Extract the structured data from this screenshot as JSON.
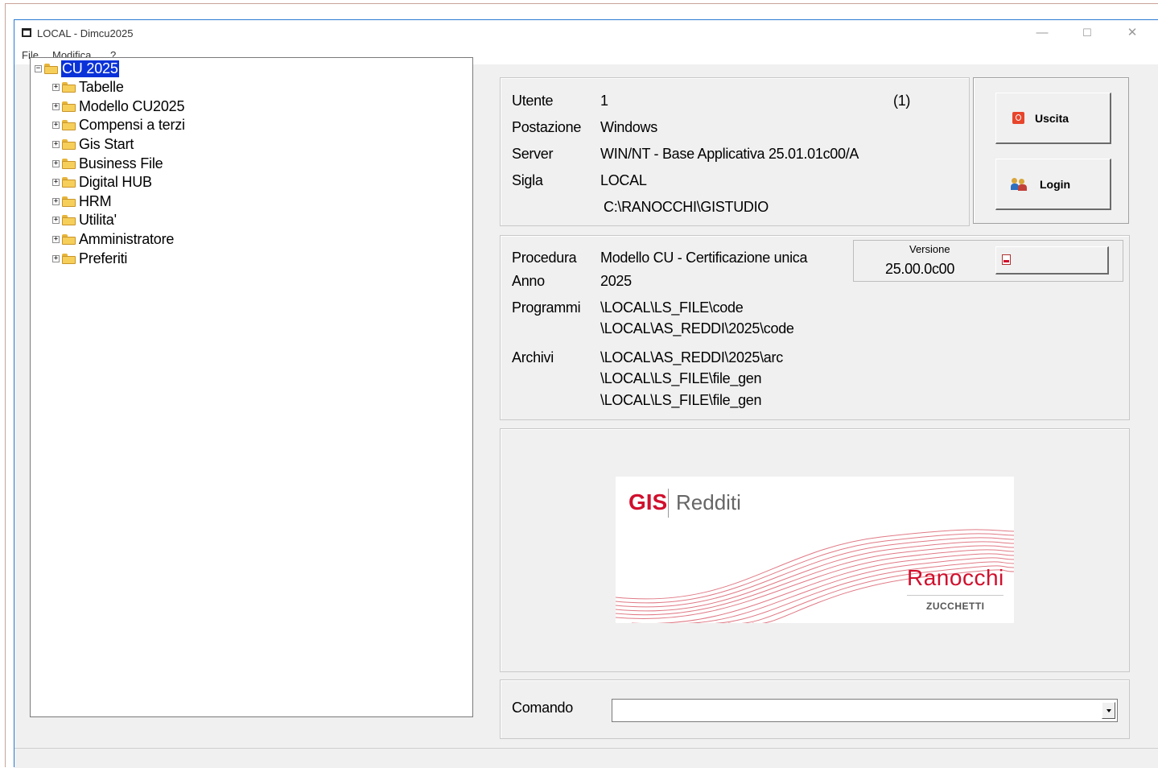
{
  "window": {
    "title": "LOCAL - Dimcu2025"
  },
  "menu": {
    "file": "File",
    "modifica": "Modifica",
    "help": "?"
  },
  "tree": {
    "root": "CU 2025",
    "items": [
      "Tabelle",
      "Modello CU2025",
      "Compensi a terzi",
      "Gis Start",
      "Business File",
      "Digital HUB",
      "HRM",
      "Utilita'",
      "Amministratore",
      "Preferiti"
    ]
  },
  "user_info": {
    "utente_label": "Utente",
    "utente_value": "1",
    "utente_count": "(1)",
    "postazione_label": "Postazione",
    "postazione_value": "Windows",
    "server_label": "Server",
    "server_value": "WIN/NT - Base Applicativa 25.01.01c00/A",
    "sigla_label": "Sigla",
    "sigla_value": "LOCAL",
    "path_value": "C:\\RANOCCHI\\GISTUDIO"
  },
  "buttons": {
    "uscita": "Uscita",
    "login": "Login"
  },
  "procedure": {
    "procedura_label": "Procedura",
    "procedura_value": "Modello CU - Certificazione unica",
    "anno_label": "Anno",
    "anno_value": "2025",
    "programmi_label": "Programmi",
    "programmi_values": [
      "\\LOCAL\\LS_FILE\\code",
      "\\LOCAL\\AS_REDDI\\2025\\code"
    ],
    "archivi_label": "Archivi",
    "archivi_values": [
      "\\LOCAL\\AS_REDDI\\2025\\arc",
      "\\LOCAL\\LS_FILE\\file_gen",
      "\\LOCAL\\LS_FILE\\file_gen"
    ],
    "versione_label": "Versione",
    "versione_value": "25.00.0c00"
  },
  "logo": {
    "gis": "GIS",
    "redditi": "Redditi",
    "brand": "Ranocchi",
    "sub": "ZUCCHETTI"
  },
  "command": {
    "label": "Comando",
    "value": ""
  },
  "colors": {
    "accent_red": "#d0102d",
    "selection_blue": "#0a32d8",
    "window_border": "#2b7bd3"
  }
}
